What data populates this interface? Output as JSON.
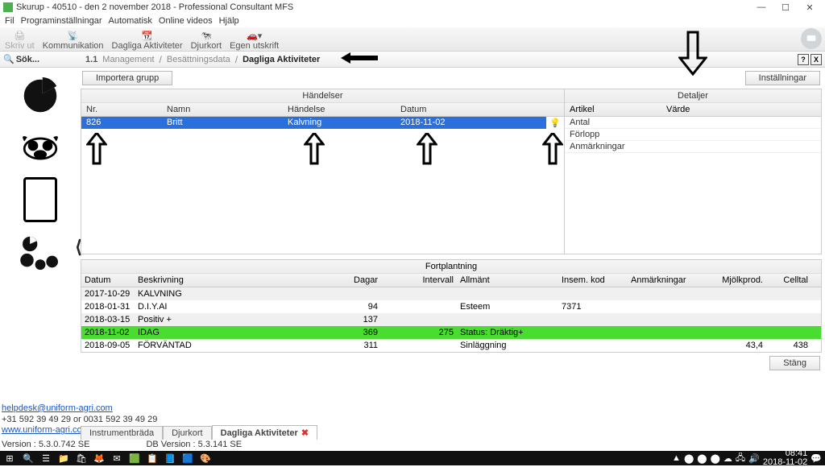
{
  "window": {
    "title": "Skurup - 40510 - den 2 november 2018 - Professional Consultant MFS"
  },
  "menu": [
    "Fil",
    "Programinställningar",
    "Automatisk",
    "Online videos",
    "Hjälp"
  ],
  "toolbar": [
    {
      "label": "Skriv ut",
      "icon": "printer",
      "disabled": true
    },
    {
      "label": "Kommunikation",
      "icon": "antenna"
    },
    {
      "label": "Dagliga Aktiviteter",
      "icon": "calendar"
    },
    {
      "label": "Djurkort",
      "icon": "cow"
    },
    {
      "label": "Egen utskrift",
      "icon": "car"
    }
  ],
  "search": {
    "placeholder": "Sök..."
  },
  "breadcrumb": {
    "num": "1.1",
    "parts": [
      "Management",
      "Besättningsdata"
    ],
    "current": "Dagliga Aktiviteter"
  },
  "buttons": {
    "import": "Importera grupp",
    "settings": "Inställningar",
    "close": "Stäng"
  },
  "events": {
    "title": "Händelser",
    "columns": {
      "nr": "Nr.",
      "namn": "Namn",
      "handelse": "Händelse",
      "datum": "Datum"
    },
    "rows": [
      {
        "nr": "826",
        "namn": "Britt",
        "handelse": "Kalvning",
        "datum": "2018-11-02"
      }
    ]
  },
  "details": {
    "title": "Detaljer",
    "columns": {
      "artikel": "Artikel",
      "varde": "Värde"
    },
    "rows": [
      {
        "artikel": "Antal",
        "varde": ""
      },
      {
        "artikel": "Förlopp",
        "varde": ""
      },
      {
        "artikel": "Anmärkningar",
        "varde": ""
      }
    ]
  },
  "fort": {
    "title": "Fortplantning",
    "columns": {
      "datum": "Datum",
      "beskrivning": "Beskrivning",
      "dagar": "Dagar",
      "intervall": "Intervall",
      "allmant": "Allmänt",
      "insem": "Insem. kod",
      "anm": "Anmärkningar",
      "mjolk": "Mjölkprod.",
      "cell": "Celltal"
    },
    "rows": [
      {
        "datum": "2017-10-29",
        "beskrivning": "KALVNING",
        "dagar": "",
        "intervall": "",
        "allmant": "",
        "insem": "",
        "anm": "",
        "mjolk": "",
        "cell": "",
        "cls": "alt"
      },
      {
        "datum": "2018-01-31",
        "beskrivning": "D.I.Y.AI",
        "dagar": "94",
        "intervall": "",
        "allmant": "Esteem",
        "insem": "7371",
        "anm": "",
        "mjolk": "",
        "cell": "",
        "cls": ""
      },
      {
        "datum": "2018-03-15",
        "beskrivning": "Positiv +",
        "dagar": "137",
        "intervall": "",
        "allmant": "",
        "insem": "",
        "anm": "",
        "mjolk": "",
        "cell": "",
        "cls": "alt"
      },
      {
        "datum": "2018-11-02",
        "beskrivning": "IDAG",
        "dagar": "369",
        "intervall": "275",
        "allmant": "Status: Dräktig+",
        "insem": "",
        "anm": "",
        "mjolk": "",
        "cell": "",
        "cls": "green"
      },
      {
        "datum": "2018-09-05",
        "beskrivning": "FÖRVÄNTAD",
        "dagar": "311",
        "intervall": "",
        "allmant": "Sinläggning",
        "insem": "",
        "anm": "",
        "mjolk": "43,4",
        "cell": "438",
        "cls": ""
      }
    ]
  },
  "tabs": [
    {
      "label": "Instrumentbräda",
      "active": false,
      "closable": false
    },
    {
      "label": "Djurkort",
      "active": false,
      "closable": false
    },
    {
      "label": "Dagliga Aktiviteter",
      "active": true,
      "closable": true
    }
  ],
  "footer": {
    "email": "helpdesk@uniform-agri.com",
    "phone1": "+31 592 39 49 29 or",
    "phone2": "0031 592 39 49 29",
    "site": "www.uniform-agri.com",
    "version": "Version : 5.3.0.742 SE",
    "dbversion": "DB Version : 5.3.141 SE"
  },
  "taskbar": {
    "time": "08:41",
    "date": "2018-11-02"
  }
}
